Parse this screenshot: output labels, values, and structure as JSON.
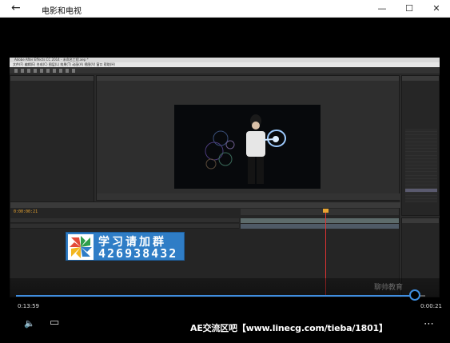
{
  "window": {
    "title": "电影和电视",
    "back_icon": "←",
    "minimize_icon": "—",
    "maximize_icon": "☐",
    "close_icon": "✕"
  },
  "ae": {
    "title_text": "Adobe After Effects CC 2014 - 未命名工程.aep *",
    "menu_text": "文件(F) 编辑(E) 合成(C) 图层(L) 效果(T) 动画(A) 视图(V) 窗口 帮助(H)",
    "timecode": "0:00:00:21"
  },
  "banner": {
    "line1": "学习请加群",
    "line2": "426938432"
  },
  "watermark": "聊帅教育",
  "player": {
    "elapsed": "0:13:59",
    "remaining": "0:00:21",
    "progress": 0.975,
    "subtitle": "AE交流区吧【www.linecg.com/tieba/1801】",
    "volume_icon": "🔈",
    "captions_icon": "▭",
    "more_icon": "⋯"
  },
  "colors": {
    "accent": "#3f8ddf",
    "banner_blue": "#2f7dc6",
    "timecode_orange": "#e8a431"
  }
}
